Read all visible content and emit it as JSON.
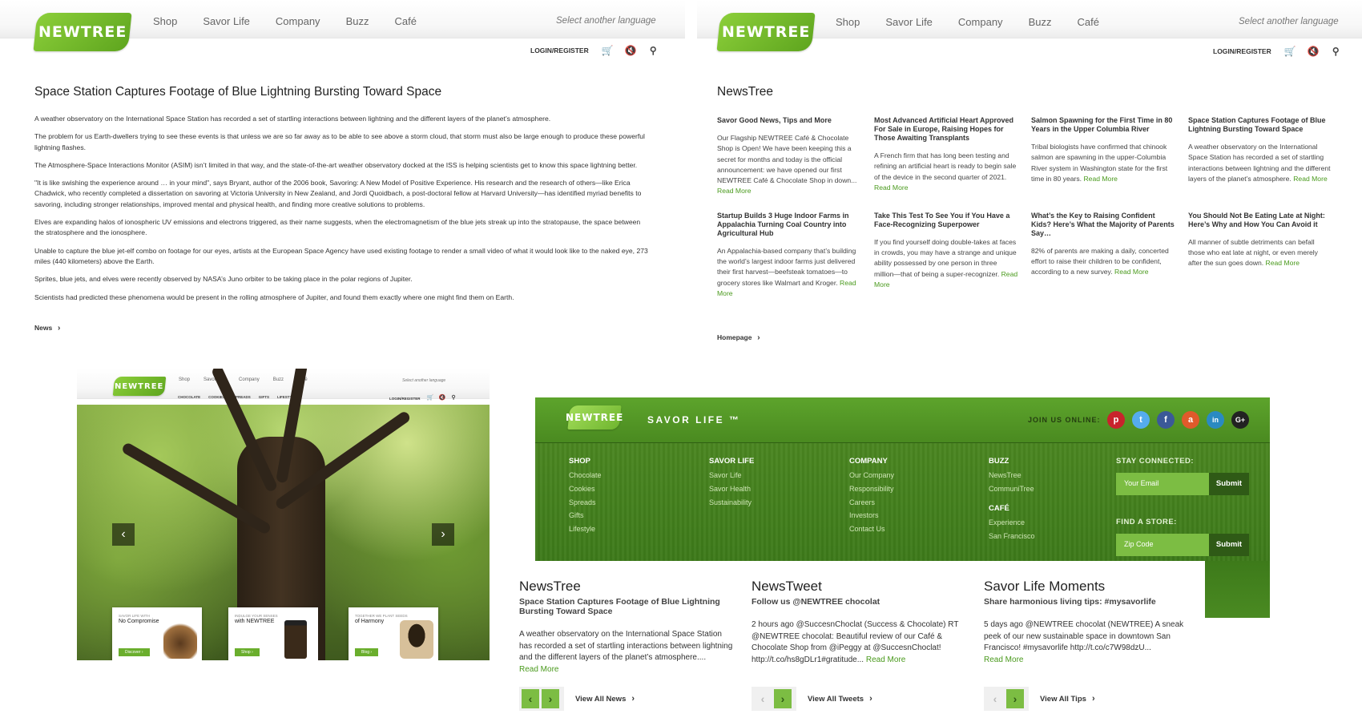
{
  "brand": {
    "logo_text": "NEWTREE",
    "accent": "#6aae2d",
    "dark_green": "#3d7a1a"
  },
  "nav": {
    "items": [
      "Shop",
      "Savor Life",
      "Company",
      "Buzz",
      "Café"
    ],
    "language": "Select another language"
  },
  "util": {
    "login": "LOGIN/REGISTER",
    "icons": [
      "cart-icon",
      "mute-icon",
      "search-icon"
    ]
  },
  "article": {
    "title": "Space Station Captures Footage of Blue Lightning Bursting Toward Space",
    "paragraphs": [
      "A weather observatory on the International Space Station has recorded a set of startling interactions between lightning and the different layers of the planet’s atmosphere.",
      "The problem for us Earth-dwellers trying to see these events is that unless we are so far away as to be able to see above a storm cloud, that storm must also be large enough to produce these powerful lightning flashes.",
      "The Atmosphere-Space Interactions Monitor (ASIM) isn’t limited in that way, and the state-of-the-art weather observatory docked at the ISS is helping scientists get to know this space lightning better.",
      "\"It is like swishing the experience around … in your mind\", says Bryant, author of the 2006 book, Savoring: A New Model of Positive Experience. His research and the research of others—like Erica Chadwick, who recently completed a dissertation on savoring at Victoria University in New Zealand, and Jordi Quoidbach, a post-doctoral fellow at Harvard University—has identified myriad benefits to savoring, including stronger relationships, improved mental and physical health, and finding more creative solutions to problems.",
      "Elves are expanding halos of ionospheric UV emissions and electrons triggered, as their name suggests, when the electromagnetism of the blue jets streak up into the stratopause, the space between the stratosphere and the ionosphere.",
      "Unable to capture the blue jet-elf combo on footage for our eyes, artists at the European Space Agency have used existing footage to render a small video of what it would look like to the naked eye, 273 miles (440 kilometers) above the Earth.",
      "Sprites, blue jets, and elves were recently observed by NASA’s Juno orbiter to be taking place in the polar regions of Jupiter.",
      "Scientists had predicted these phenomena would be present in the rolling atmosphere of Jupiter, and found them exactly where one might find them on Earth."
    ],
    "crumb": "News"
  },
  "newslist": {
    "title": "NewsTree",
    "read_more": "Read More",
    "crumb": "Homepage",
    "items": [
      {
        "h": "Savor Good News, Tips and More",
        "p": "Our Flagship NEWTREE Café & Chocolate Shop is Open! We have been keeping this a secret for months and today is the official announcement: we have opened our first NEWTREE Café & Chocolate Shop in down..."
      },
      {
        "h": "Most Advanced Artificial Heart Approved For Sale in Europe, Raising Hopes for Those Awaiting Transplants",
        "p": "A French firm that has long been testing and refining an artificial heart is ready to begin sale of the device in the second quarter of 2021."
      },
      {
        "h": "Salmon Spawning for the First Time in 80 Years in the Upper Columbia River",
        "p": "Tribal biologists have confirmed that chinook salmon are spawning in the upper-Columbia River system in Washington state for the first time in 80 years."
      },
      {
        "h": "Space Station Captures Footage of Blue Lightning Bursting Toward Space",
        "p": "A weather observatory on the International Space Station has recorded a set of startling interactions between lightning and the different layers of the planet’s atmosphere."
      },
      {
        "h": "Startup Builds 3 Huge Indoor Farms in Appalachia Turning Coal Country into Agricultural Hub",
        "p": "An Appalachia-based company that’s building the world’s largest indoor farms just delivered their first harvest—beefsteak tomatoes—to grocery stores like Walmart and Kroger."
      },
      {
        "h": "Take This Test To See You if You Have a Face-Recognizing Superpower",
        "p": "If you find yourself doing double-takes at faces in crowds, you may have a strange and unique ability possessed by one person in three million—that of being a super-recognizer."
      },
      {
        "h": "What’s the Key to Raising Confident Kids? Here’s What the Majority of Parents Say…",
        "p": "82% of parents are making a daily, concerted effort to raise their children to be confident, according to a new survey."
      },
      {
        "h": "You Should Not Be Eating Late at Night: Here’s Why and How You Can Avoid it",
        "p": "All manner of subtle detriments can befall those who eat late at night, or even merely after the sun goes down."
      }
    ]
  },
  "home": {
    "subnav": [
      "CHOCOLATE",
      "COOKIES",
      "SPREADS",
      "GIFTS",
      "LIFESTYLE"
    ],
    "promos": [
      {
        "small": "SAVOR LIFE WITH",
        "big": "No Compromise",
        "btn": "Discover ›"
      },
      {
        "small": "INDULGE YOUR SENSES",
        "big": "with NEWTREE",
        "btn": "Shop ›"
      },
      {
        "small": "TOGETHER WE PLANT SEEDS",
        "big": "of Harmony",
        "btn": "Blog ›"
      }
    ]
  },
  "footer": {
    "tagline": "SAVOR LIFE ™",
    "join": "JOIN US ONLINE:",
    "social": [
      {
        "name": "pinterest-icon",
        "glyph": "p",
        "color": "#c8232c"
      },
      {
        "name": "twitter-icon",
        "glyph": "t",
        "color": "#55acee"
      },
      {
        "name": "facebook-icon",
        "glyph": "f",
        "color": "#3b5998"
      },
      {
        "name": "amazon-icon",
        "glyph": "a",
        "color": "#e05a2b"
      },
      {
        "name": "linkedin-icon",
        "glyph": "in",
        "color": "#2a8ac2"
      },
      {
        "name": "googleplus-icon",
        "glyph": "G+",
        "color": "#222222"
      }
    ],
    "cols": [
      {
        "h": "SHOP",
        "items": [
          "Chocolate",
          "Cookies",
          "Spreads",
          "Gifts",
          "Lifestyle"
        ]
      },
      {
        "h": "SAVOR LIFE",
        "items": [
          "Savor Life",
          "Savor Health",
          "Sustainability"
        ]
      },
      {
        "h": "COMPANY",
        "items": [
          "Our Company",
          "Responsibility",
          "Careers",
          "Investors",
          "Contact Us"
        ]
      },
      {
        "h": "BUZZ",
        "items": [
          "NewsTree",
          "CommuniTree"
        ]
      },
      {
        "h": "CAFÉ",
        "items": [
          "Experience",
          "San Francisco"
        ]
      }
    ],
    "stay": "STAY CONNECTED:",
    "email_placeholder": "Your Email",
    "find": "FIND A STORE:",
    "zip_placeholder": "Zip Code",
    "submit": "Submit"
  },
  "widgets": [
    {
      "title": "NewsTree",
      "sub": "Space Station Captures Footage of Blue Lightning Bursting Toward Space",
      "body": "A weather observatory on the International Space Station has recorded a set of startling interactions between lightning and the different layers of the planet’s atmosphere....",
      "rm": "Read More",
      "link": "View All News"
    },
    {
      "title": "NewsTweet",
      "sub": "Follow us @NEWTREE chocolat",
      "body": "2 hours ago @SuccesnChoclat (Success & Chocolate) RT @NEWTREE chocolat: Beautiful review of our Café & Chocolate Shop from @iPeggy at @SuccesnChoclat! http://t.co/hs8gDLr1#gratitude...",
      "rm": "Read More",
      "link": "View All Tweets"
    },
    {
      "title": "Savor Life Moments",
      "sub": "Share harmonious living tips: #mysavorlife",
      "body": "5 days ago @NEWTREE chocolat (NEWTREE) A sneak peek of our new sustainable space in downtown San Francisco! #mysavorlife http://t.co/c7W98dzU...",
      "rm": "Read More",
      "link": "View All Tips"
    }
  ]
}
